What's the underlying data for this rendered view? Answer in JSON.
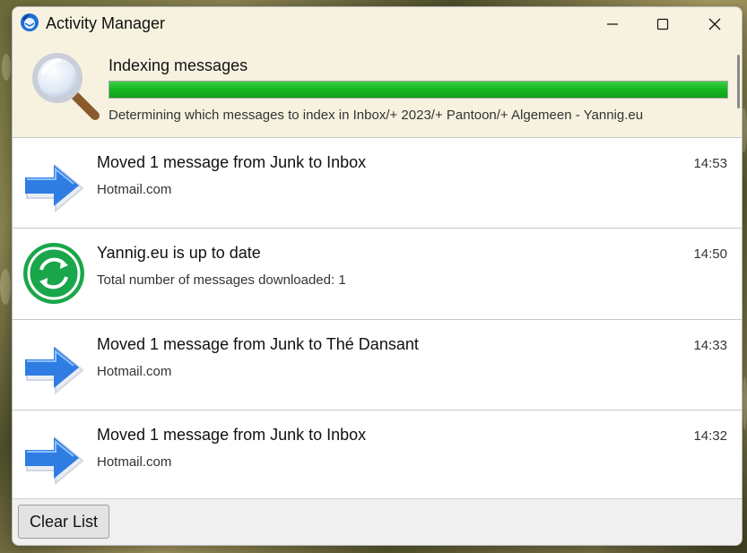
{
  "window": {
    "title": "Activity Manager"
  },
  "window_controls": {
    "minimize": "minimize-icon",
    "maximize": "maximize-icon",
    "close": "close-icon"
  },
  "activity": {
    "title": "Indexing messages",
    "progress_percent": 100,
    "status": "Determining which messages to index in Inbox/+ 2023/+ Pantoon/+ Algemeen - Yannig.eu",
    "icon": "magnifier-icon"
  },
  "events": [
    {
      "title": "Moved 1 message from Junk to Inbox",
      "subtitle": "Hotmail.com",
      "time": "14:53",
      "icon": "arrow-right-icon"
    },
    {
      "title": "Yannig.eu is up to date",
      "subtitle": "Total number of messages downloaded: 1",
      "time": "14:50",
      "icon": "sync-icon"
    },
    {
      "title": "Moved 1 message from Junk to Thé Dansant",
      "subtitle": "Hotmail.com",
      "time": "14:33",
      "icon": "arrow-right-icon"
    },
    {
      "title": "Moved 1 message from Junk to Inbox",
      "subtitle": "Hotmail.com",
      "time": "14:32",
      "icon": "arrow-right-icon"
    }
  ],
  "footer": {
    "clear_label": "Clear List"
  },
  "colors": {
    "progress": "#14b51f",
    "titlebar": "#f7f2e0",
    "arrow": "#2f7de3",
    "sync": "#1aa64a"
  }
}
